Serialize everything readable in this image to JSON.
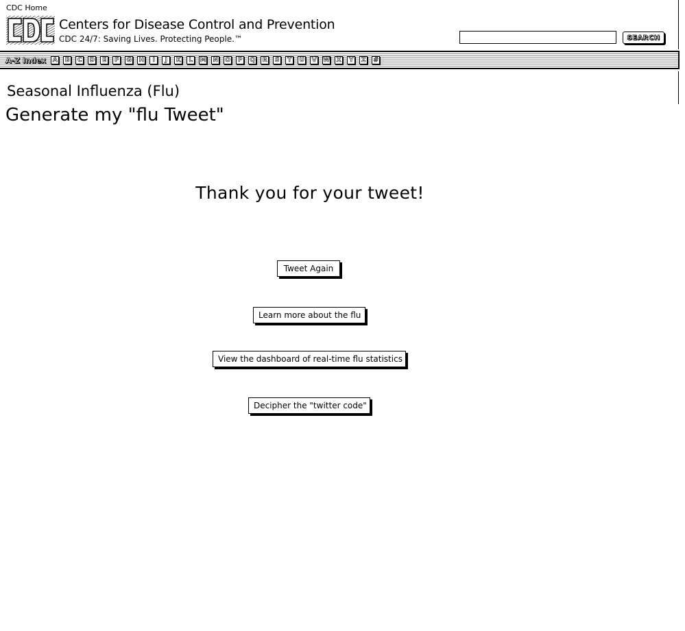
{
  "header": {
    "home_link": "CDC Home",
    "org_name": "Centers for Disease Control and Prevention",
    "tagline": "CDC 24/7: Saving Lives. Protecting People.™",
    "search": {
      "value": "",
      "button_label": "SEARCH"
    }
  },
  "az_index": {
    "label": "A-Z Index",
    "letters": [
      "A",
      "B",
      "C",
      "D",
      "E",
      "F",
      "G",
      "H",
      "I",
      "J",
      "K",
      "L",
      "M",
      "N",
      "O",
      "P",
      "Q",
      "R",
      "S",
      "T",
      "U",
      "V",
      "W",
      "X",
      "Y",
      "Z",
      "#"
    ]
  },
  "page": {
    "section_title": "Seasonal Influenza (Flu)",
    "title": "Generate my \"flu Tweet\"",
    "thank_you": "Thank you for your tweet!"
  },
  "actions": {
    "tweet_again": "Tweet Again",
    "learn_more": "Learn more about the flu",
    "dashboard": "View the dashboard of real-time flu statistics",
    "decipher": "Decipher the \"twitter code\""
  }
}
